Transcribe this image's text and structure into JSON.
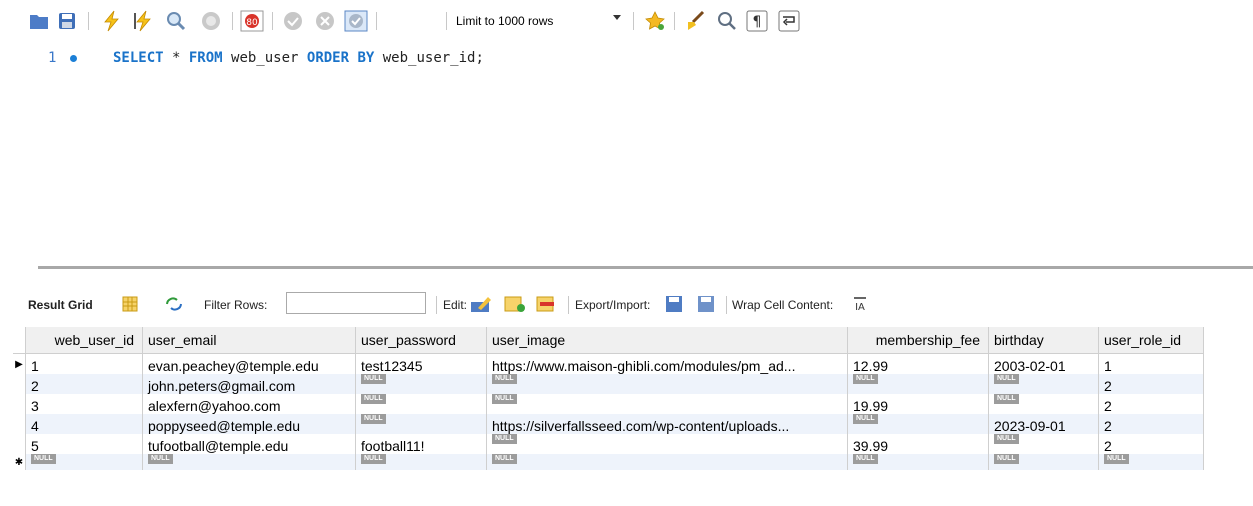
{
  "toolbar": {
    "icons": [
      "folder-icon",
      "save-icon",
      "execute-icon",
      "execute-current-icon",
      "explain-icon",
      "stop-icon",
      "toggle-error-icon",
      "commit-icon",
      "rollback-icon",
      "autocommit-icon",
      "bookmark-icon",
      "beautify-icon",
      "find-icon",
      "invisible-chars-icon",
      "wrap-icon"
    ],
    "limit_select": "Limit to 1000 rows"
  },
  "editor": {
    "line_number": "1",
    "code_tokens": [
      {
        "t": "SELECT",
        "kw": true
      },
      {
        "t": " * ",
        "kw": false
      },
      {
        "t": "FROM",
        "kw": true
      },
      {
        "t": " web_user ",
        "kw": false
      },
      {
        "t": "ORDER BY",
        "kw": true
      },
      {
        "t": " web_user_id;",
        "kw": false
      }
    ]
  },
  "result_bar": {
    "result_grid": "Result Grid",
    "filter_rows": "Filter Rows:",
    "edit": "Edit:",
    "export_import": "Export/Import:",
    "wrap_cell": "Wrap Cell Content:"
  },
  "grid": {
    "columns": [
      "web_user_id",
      "user_email",
      "user_password",
      "user_image",
      "membership_fee",
      "birthday",
      "user_role_id"
    ],
    "rows": [
      [
        "1",
        "evan.peachey@temple.edu",
        "test12345",
        "https://www.maison-ghibli.com/modules/pm_ad...",
        "12.99",
        "2003-02-01",
        "1"
      ],
      [
        "2",
        "john.peters@gmail.com",
        "NULL",
        "NULL",
        "NULL",
        "NULL",
        "2"
      ],
      [
        "3",
        "alexfern@yahoo.com",
        "NULL",
        "NULL",
        "19.99",
        "NULL",
        "2"
      ],
      [
        "4",
        "poppyseed@temple.edu",
        "NULL",
        "https://silverfallsseed.com/wp-content/uploads...",
        "NULL",
        "2023-09-01",
        "2"
      ],
      [
        "5",
        "tufootball@temple.edu",
        "football11!",
        "NULL",
        "39.99",
        "NULL",
        "2"
      ]
    ],
    "new_row": [
      "NULL",
      "NULL",
      "NULL",
      "NULL",
      "NULL",
      "NULL",
      "NULL"
    ],
    "null_label": "NULL"
  }
}
